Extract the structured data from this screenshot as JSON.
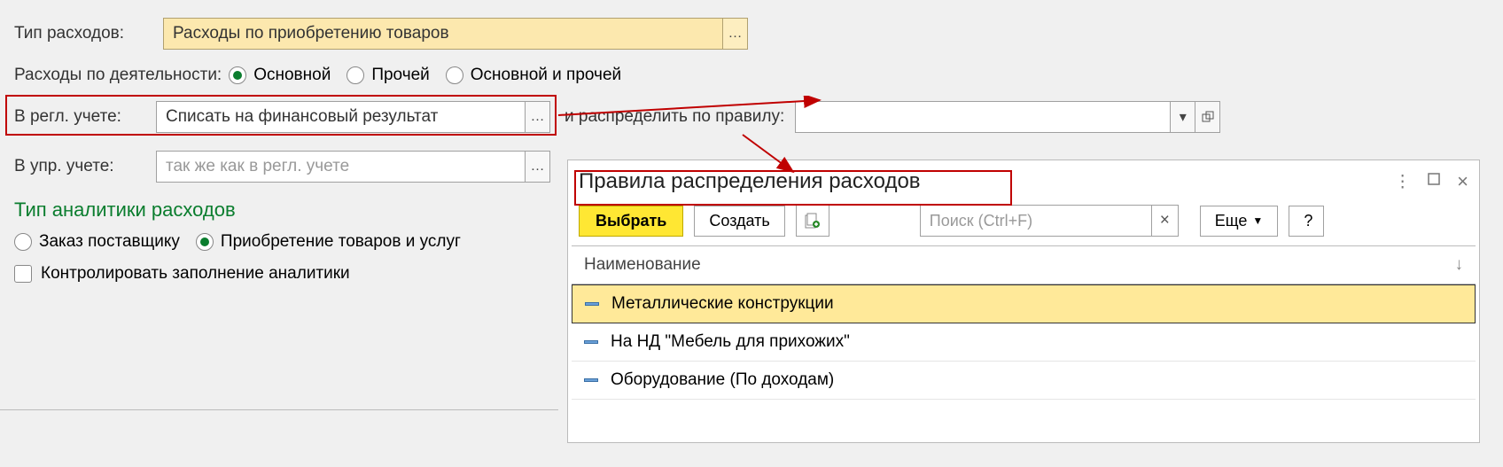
{
  "labels": {
    "expense_type": "Тип расходов:",
    "activity": "Расходы по деятельности:",
    "in_regl": "В регл. учете:",
    "rule": "и распределить по правилу:",
    "in_mgmt": "В упр. учете:",
    "section": "Тип аналитики расходов",
    "control": "Контролировать заполнение аналитики"
  },
  "expense_type_value": "Расходы по приобретению товаров",
  "activity_options": [
    "Основной",
    "Прочей",
    "Основной и прочей"
  ],
  "activity_selected": 0,
  "regl_value": "Списать на финансовый результат",
  "mgmt_placeholder": "так же как в регл. учете",
  "rule_value": "",
  "analytics_options": [
    "Заказ поставщику",
    "Приобретение товаров и услуг"
  ],
  "analytics_selected": 1,
  "popup": {
    "title": "Правила распределения расходов",
    "select_btn": "Выбрать",
    "create_btn": "Создать",
    "search_placeholder": "Поиск (Ctrl+F)",
    "more_btn": "Еще",
    "help_btn": "?",
    "column": "Наименование",
    "items": [
      "Металлические конструкции",
      "На НД \"Мебель для прихожих\"",
      "Оборудование (По доходам)"
    ],
    "selected_index": 0
  }
}
